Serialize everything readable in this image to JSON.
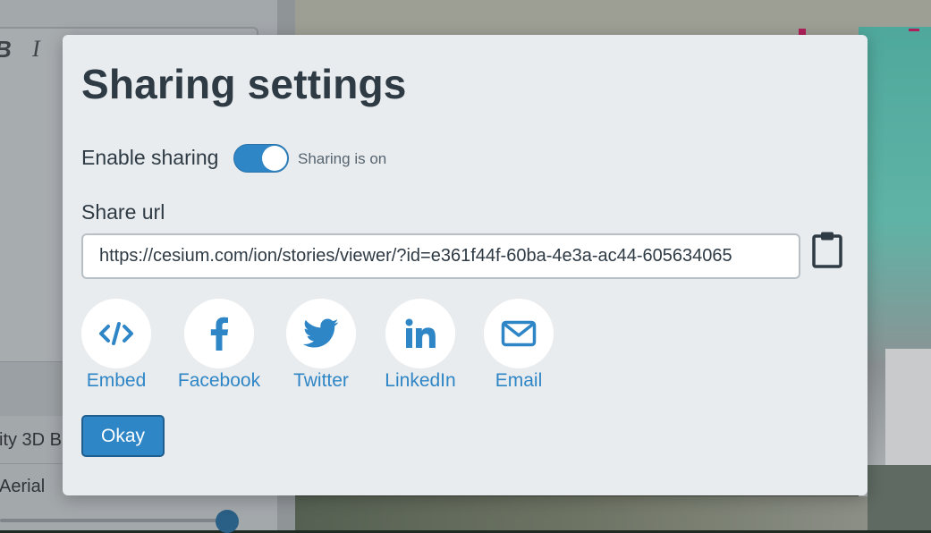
{
  "background_editor": {
    "format_bold": "B",
    "format_italic": "I",
    "layers": [
      {
        "label": "ity 3D B"
      },
      {
        "label": "Aerial"
      }
    ]
  },
  "modal": {
    "title": "Sharing settings",
    "enable_sharing_label": "Enable sharing",
    "sharing_enabled": true,
    "sharing_status": "Sharing is on",
    "share_url_label": "Share url",
    "share_url_value": "https://cesium.com/ion/stories/viewer/?id=e361f44f-60ba-4e3a-ac44-605634065",
    "copy_icon": "clipboard-icon",
    "share_options": [
      {
        "label": "Embed",
        "icon": "code-icon"
      },
      {
        "label": "Facebook",
        "icon": "facebook-icon"
      },
      {
        "label": "Twitter",
        "icon": "twitter-icon"
      },
      {
        "label": "LinkedIn",
        "icon": "linkedin-icon"
      },
      {
        "label": "Email",
        "icon": "envelope-icon"
      }
    ],
    "okay_label": "Okay"
  },
  "colors": {
    "accent": "#2f86c6",
    "modal_background": "#e9ecee",
    "title_text": "#2e3a44"
  }
}
